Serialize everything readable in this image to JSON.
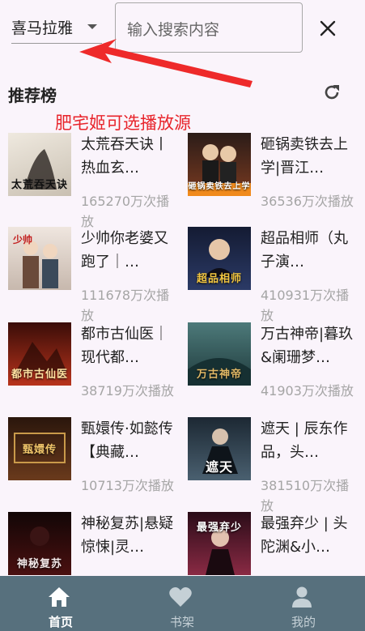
{
  "top": {
    "source_label": "喜马拉雅",
    "search_placeholder": "输入搜索内容"
  },
  "annotation": {
    "text": "肥宅姬可选播放源",
    "color": "#e8242b"
  },
  "section": {
    "title": "推荐榜"
  },
  "books": [
    {
      "title": "太荒吞天诀丨热血玄…",
      "plays": "165270万次播放",
      "cover_text": "太荒吞天诀",
      "cover_bg": "#d8d2c8"
    },
    {
      "title": "砸锅卖铁去上学|晋江…",
      "plays": "36536万次播放",
      "cover_text": "砸锅卖铁去上学",
      "cover_bg": "#3a2a24"
    },
    {
      "title": "少帅你老婆又跑了｜…",
      "plays": "111678万次播放",
      "cover_text": "",
      "cover_bg": "#d9cfc7"
    },
    {
      "title": "超品相师（丸子演…",
      "plays": "410931万次播放",
      "cover_text": "超品相师",
      "cover_bg": "#1e2a4a"
    },
    {
      "title": "都市古仙医｜现代都…",
      "plays": "38719万次播放",
      "cover_text": "都市古仙医",
      "cover_bg": "#7a1f14"
    },
    {
      "title": "万古神帝|暮玖&阑珊梦…",
      "plays": "41903万次播放",
      "cover_text": "万古神帝",
      "cover_bg": "#2f5a5c"
    },
    {
      "title": "甄嬛传·如懿传【典藏…",
      "plays": "10713万次播放",
      "cover_text": "甄嬛传",
      "cover_bg": "#4a2a18"
    },
    {
      "title": "遮天 | 辰东作品，头…",
      "plays": "381510万次播放",
      "cover_text": "遮天",
      "cover_bg": "#2c3e4f"
    },
    {
      "title": "神秘复苏|悬疑惊悚|灵…",
      "plays": "",
      "cover_text": "神秘复苏",
      "cover_bg": "#2a1010"
    },
    {
      "title": "最强弃少 | 头陀渊&小…",
      "plays": "",
      "cover_text": "最强弃少",
      "cover_bg": "#4a1a2a"
    }
  ],
  "nav": [
    {
      "label": "首页",
      "icon": "home-icon",
      "active": true
    },
    {
      "label": "书架",
      "icon": "heart-icon",
      "active": false
    },
    {
      "label": "我的",
      "icon": "person-icon",
      "active": false
    }
  ],
  "colors": {
    "background": "#faf4fb",
    "nav_bg": "#57707d",
    "plays_text": "#a5a5a5"
  }
}
